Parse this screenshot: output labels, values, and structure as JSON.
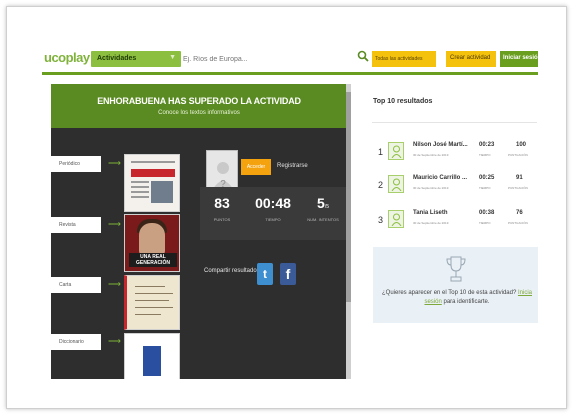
{
  "header": {
    "logo": "ucoplay",
    "category_button": "Actividades",
    "search_placeholder": "Ej. Ríos de Europa...",
    "all_activities": "Todas las actividades",
    "create_activity": "Crear actividad",
    "login": "Iniciar sesión"
  },
  "banner": {
    "title": "ENHORABUENA HAS SUPERADO LA ACTIVIDAD",
    "subtitle": "Conoce los textos informativos"
  },
  "items": [
    {
      "label": "Periódico"
    },
    {
      "label": "Revista"
    },
    {
      "label": "Carta"
    },
    {
      "label": "Diccionario"
    }
  ],
  "magazine_title": "UNA REAL GENERACIÓN",
  "profile": {
    "avatar_glyph": "?",
    "accept_button": "Acceder",
    "register_link": "Registrarse"
  },
  "stats": [
    {
      "value": "83",
      "unit": "",
      "label": "PUNTOS"
    },
    {
      "value": "00:48",
      "unit": "",
      "label": "TIEMPO"
    },
    {
      "value": "5",
      "unit": "/5",
      "label": "NUM. INTENTOS"
    }
  ],
  "share": {
    "label": "Compartir resultado:",
    "twitter": "t",
    "facebook": "f"
  },
  "top10": {
    "title": "Top 10 resultados",
    "rows": [
      {
        "rank": "1",
        "name": "Nilson José Martí...",
        "date": "30 de Septiembre de 2019",
        "time": "00:23",
        "time_label": "TIEMPO",
        "score": "100",
        "score_label": "PUNTUACIÓN"
      },
      {
        "rank": "2",
        "name": "Mauricio Carrillo ...",
        "date": "30 de Septiembre de 2019",
        "time": "00:25",
        "time_label": "TIEMPO",
        "score": "91",
        "score_label": "PUNTUACIÓN"
      },
      {
        "rank": "3",
        "name": "Tania Liseth",
        "date": "30 de Septiembre de 2019",
        "time": "00:38",
        "time_label": "TIEMPO",
        "score": "76",
        "score_label": "PUNTUACIÓN"
      }
    ],
    "promo_text": "¿Quieres aparecer en el Top 10 de esta actividad?",
    "promo_link1": "Inicia sesión",
    "promo_text2": "para identificarte."
  },
  "colors": {
    "brand_green": "#6a9e1f",
    "accent_yellow": "#f4c20d",
    "panel_dark": "#2e2e2e",
    "twitter_blue": "#3d8fcf",
    "facebook_blue": "#3b5b98"
  }
}
